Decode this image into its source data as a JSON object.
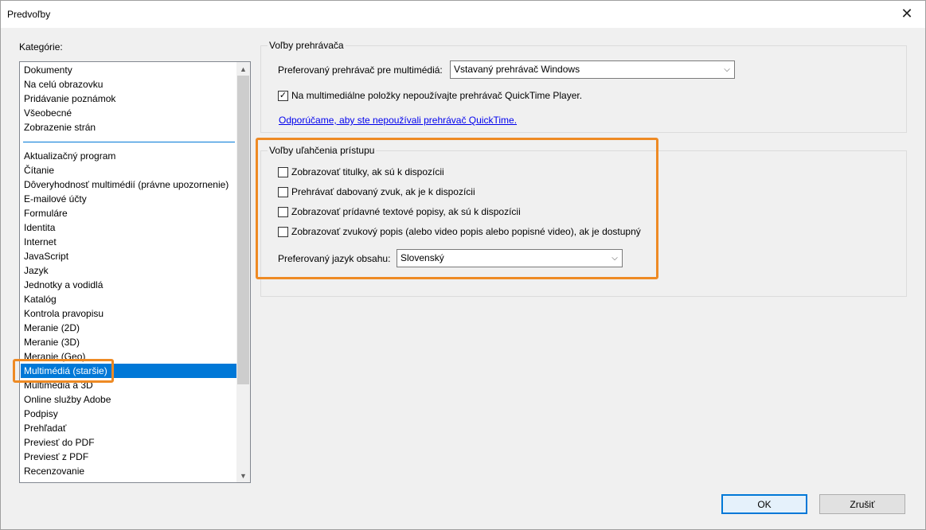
{
  "window": {
    "title": "Predvoľby"
  },
  "categories": {
    "label": "Kategórie:",
    "group1": [
      "Dokumenty",
      "Na celú obrazovku",
      "Pridávanie poznámok",
      "Všeobecné",
      "Zobrazenie strán"
    ],
    "group2": [
      "Aktualizačný program",
      "Čítanie",
      "Dôveryhodnosť multimédií (právne upozornenie)",
      "E-mailové účty",
      "Formuláre",
      "Identita",
      "Internet",
      "JavaScript",
      "Jazyk",
      "Jednotky a vodidlá",
      "Katalóg",
      "Kontrola pravopisu",
      "Meranie (2D)",
      "Meranie (3D)",
      "Meranie (Geo)",
      "Multimédiá (staršie)",
      "Multimédiá a 3D",
      "Online služby Adobe",
      "Podpisy",
      "Prehľadať",
      "Previesť do PDF",
      "Previesť z PDF",
      "Recenzovanie"
    ],
    "selected": "Multimédiá (staršie)"
  },
  "player_options": {
    "title": "Voľby prehrávača",
    "preferred_player_label": "Preferovaný prehrávač pre multimédiá:",
    "preferred_player_value": "Vstavaný prehrávač Windows",
    "quicktime_checkbox_label": "Na multimediálne položky nepoužívajte prehrávač QuickTime Player.",
    "quicktime_checked": true,
    "recommend_link": "Odporúčame, aby ste nepoužívali prehrávač QuickTime."
  },
  "accessibility_options": {
    "title": "Voľby uľahčenia prístupu",
    "checkboxes": [
      {
        "label": "Zobrazovať titulky, ak sú k dispozícii",
        "checked": false
      },
      {
        "label": "Prehrávať dabovaný zvuk, ak je k dispozícii",
        "checked": false
      },
      {
        "label": "Zobrazovať prídavné textové popisy, ak sú k dispozícii",
        "checked": false
      },
      {
        "label": "Zobrazovať zvukový popis (alebo video popis alebo popisné video), ak je dostupný",
        "checked": false
      }
    ],
    "language_label": "Preferovaný jazyk obsahu:",
    "language_value": "Slovenský"
  },
  "buttons": {
    "ok": "OK",
    "cancel": "Zrušiť"
  },
  "colors": {
    "accent": "#0078d7",
    "highlight": "#ee8a24",
    "link": "#0000ee"
  },
  "icons": {
    "close": "close-icon",
    "scroll_up": "chevron-up-icon",
    "scroll_down": "chevron-down-icon",
    "dropdown": "chevron-down-icon",
    "check": "check-icon"
  }
}
